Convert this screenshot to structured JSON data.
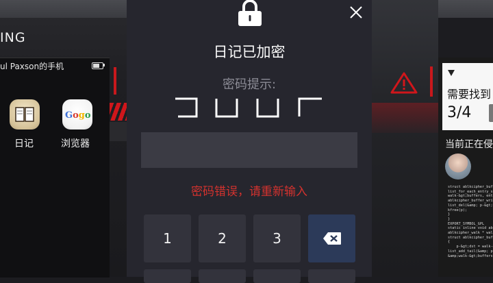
{
  "background": {
    "partial_heading": "ING",
    "phone_status": "ul Paxson的手机",
    "apps": [
      {
        "label": "日记",
        "icon": "book-icon"
      },
      {
        "label": "浏览器",
        "icon": "browser-icon"
      }
    ],
    "right_card": {
      "prompt": "需要找到",
      "count": "3/4"
    },
    "now_text": "当前正在侵",
    "code_lines": [
      "struct ablkcipher_buffer",
      "list_for_each_entry_saf",
      "walk-&gt;buffers, entry)",
      "ablkcipher_buffer_write",
      "list_del(&amp; p-&gt;en",
      "kfree(p);",
      "}",
      "}",
      "EXPORT_SYMBOL_GPL",
      "static inline void ablkcip",
      "ablkcipher_walk * walk,",
      "struct ablkcipher_buffer",
      "{",
      "    p-&gt;dst = walk-&g",
      "list_add_tail(&amp; p-",
      "&amp;walk-&gt;buffers"
    ]
  },
  "dialog": {
    "title": "日记已加密",
    "hint_label": "密码提示:",
    "password_value": "",
    "error_message": "密码错误，请重新输入",
    "keys": [
      "1",
      "2",
      "3"
    ],
    "icons": {
      "lock": "lock-icon",
      "close": "close-icon",
      "backspace": "backspace-icon"
    }
  },
  "colors": {
    "dialog_bg": "#26262e",
    "error": "#d3322e",
    "key_bg": "#33333c",
    "delete_key_bg": "#2c3a59",
    "alert_red": "#c9181c"
  }
}
